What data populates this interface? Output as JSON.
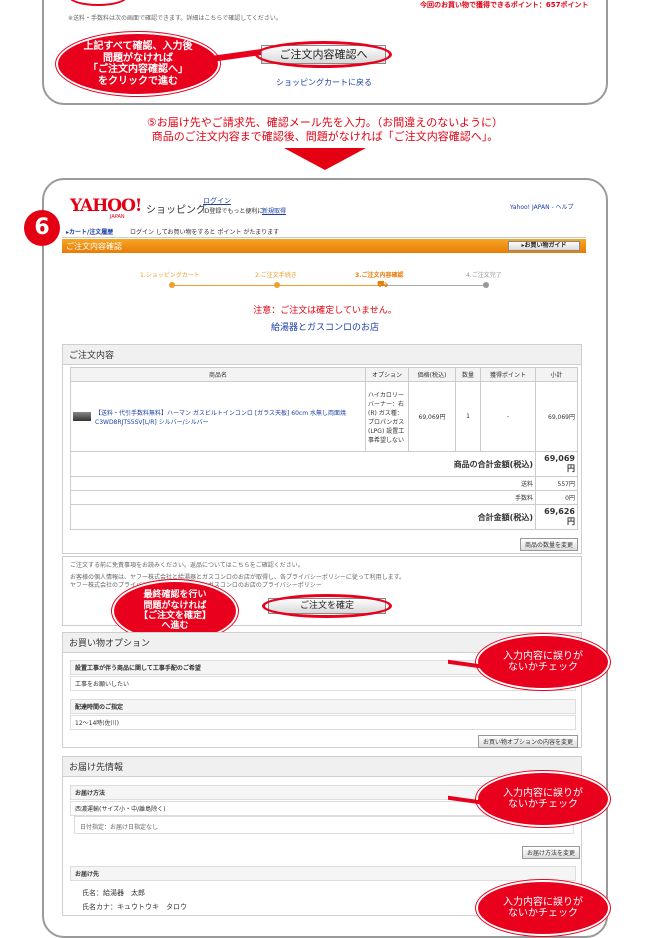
{
  "top": {
    "points_text": "今回のお買い物で獲得できるポイント：657ポイント",
    "note_line": "※送料・手数料は次の画面で確認できます。詳細はこちらで確認してください。",
    "confirm_button": "ご注文内容確認へ",
    "back_link": "ショッピングカートに戻る",
    "callout": "上記すべて確認、入力後\n問題がなければ\n「ご注文内容確認へ」\nをクリックで進む"
  },
  "step5": {
    "line1": "⑤お届け先やご請求先、確認メール先を入力。（お間違えのないように）",
    "line2": "商品のご注文内容まで確認後、問題がなければ「ご注文内容確認へ」。"
  },
  "step6": {
    "badge": "6",
    "logo": "YAHOO!",
    "logo_sub": "JAPAN",
    "shopping": "ショッピング",
    "login": "ログイン",
    "login_note": "ID登録でもっと便利に",
    "register": "新規取得",
    "header_links": "Yahoo! JAPAN - ヘルプ",
    "nav_cart": "▸カート/注文履歴",
    "nav_note": "ログイン してお買い物をすると ポイント がたまります",
    "title_bar": "ご注文内容確認",
    "guide_button": "▸お買い物ガイド",
    "steps": [
      "1.ショッピングカート",
      "2.ご注文手続き",
      "3.ご注文内容確認",
      "4.ご注文完了"
    ],
    "notice": "注意：ご注文は確定していません。",
    "shop_name": "給湯器とガスコンロのお店",
    "order_head": "ご注文内容",
    "table_headers": [
      "商品名",
      "オプション",
      "価格(税込)",
      "数量",
      "獲得ポイント",
      "小計"
    ],
    "item_name": "【送料・代引手数料無料】ハーマン ガスビルトインコンロ [ガラス天板] 60cm 水無し両面焼 C3WD8RJTS5SV[L/R] シルバー/シルバー",
    "item_option": "ハイカロリーバーナー：右(R) ガス種：プロパンガス(LPG) 設置工事希望しない",
    "item_price": "69,069円",
    "item_qty": "1",
    "item_point": "-",
    "item_subtotal": "69,069円",
    "goods_total_label": "商品の合計金額(税込)",
    "goods_total": "69,069円",
    "shipping_label": "送料",
    "shipping": "557円",
    "fee_label": "手数料",
    "fee": "0円",
    "grand_label": "合計金額(税込)",
    "grand_total": "69,626円",
    "change_qty": "商品の数量を変更",
    "notice_line1": "ご注文する前に免責事項をお読みください。返品についてはこちらをご確認ください。",
    "notice_line2": "お客様の個人情報は、ヤフー株式会社と給湯器とガスコンロのお店が取得し、各プライバシーポリシーに従って利用します。",
    "notice_line3": "ヤフー株式会社のプライバシーポリシー　給湯器とガスコンロのお店のプライバシーポリシー",
    "confirm_order": "ご注文を確定",
    "callout_final": "最終確認を行い\n問題がなければ\n【ご注文を確定】\nへ進む",
    "options_head": "お買い物オプション",
    "opt1_label": "設置工事が伴う商品に関して工事手配のご希望",
    "opt1_value": "工事をお願いしたい",
    "opt2_label": "配達時間のご指定",
    "opt2_value": "12〜14時(佐川)",
    "change_options": "お買い物オプションの内容を変更",
    "ship_head": "お届け先情報",
    "ship_method_label": "お届け方法",
    "ship_method_value": "西濃運輸(サイズ小・中/離島除く)",
    "date_value": "日付指定：お届け日指定なし",
    "change_ship": "お届け方法を変更",
    "dest_label": "お届け先",
    "dest_name": "氏名：給湯器　太郎",
    "dest_kana": "氏名カナ：キュウトウキ　タロウ",
    "check_callout": "入力内容に誤りが\nないかチェック"
  }
}
